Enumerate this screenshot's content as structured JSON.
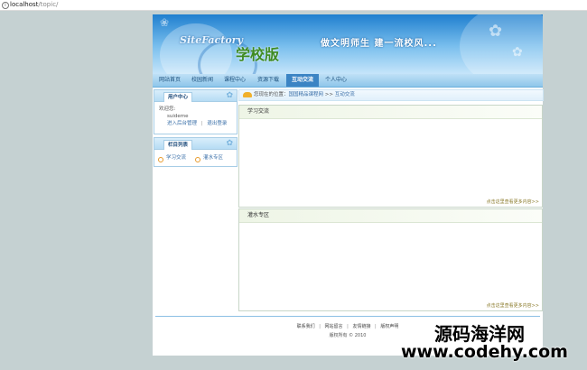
{
  "browser": {
    "host": "localhost",
    "path": "/topic/",
    "info_icon": "info-icon"
  },
  "banner": {
    "logo_en": "SiteFactory",
    "logo_cn": "学校版",
    "slogan": "做文明师生  建一流校风..."
  },
  "nav": {
    "items": [
      {
        "label": "网站首页"
      },
      {
        "label": "校园新闻"
      },
      {
        "label": "课程中心"
      },
      {
        "label": "资源下载"
      },
      {
        "label": "互动交流"
      },
      {
        "label": "个人中心"
      }
    ],
    "active_index": 4
  },
  "user_panel": {
    "title": "用户中心",
    "welcome": "欢迎您:",
    "username": "suideme",
    "admin_link": "进入后台管理",
    "separator": "|",
    "logout_link": "退出登录"
  },
  "column_panel": {
    "title": "栏目列表",
    "items": [
      {
        "label": "学习交流"
      },
      {
        "label": "灌水专区"
      }
    ]
  },
  "breadcrumb": {
    "prefix": "您现在的位置：",
    "site": "国国精品课程网",
    "arrows": ">>",
    "current": "互动交流"
  },
  "sections": [
    {
      "title": "学习交流",
      "more": "点击这里查看更多内容>>"
    },
    {
      "title": "灌水专区",
      "more": "点击这里查看更多内容>>"
    }
  ],
  "footer": {
    "links": [
      {
        "label": "联系我们"
      },
      {
        "label": "网站留言"
      },
      {
        "label": "友情链接"
      },
      {
        "label": "版权声明"
      }
    ],
    "link_separator": "|",
    "copyright": "版权所有 © 2010"
  },
  "watermark": {
    "line1": "源码海洋网",
    "line2": "www.codehy.com"
  },
  "colors": {
    "background": "#c5d1d2",
    "nav_active": "#3b84c4",
    "banner_blue": "#1f7fcf",
    "logo_green": "#3e8b22",
    "more_link": "#8a7a2a"
  }
}
